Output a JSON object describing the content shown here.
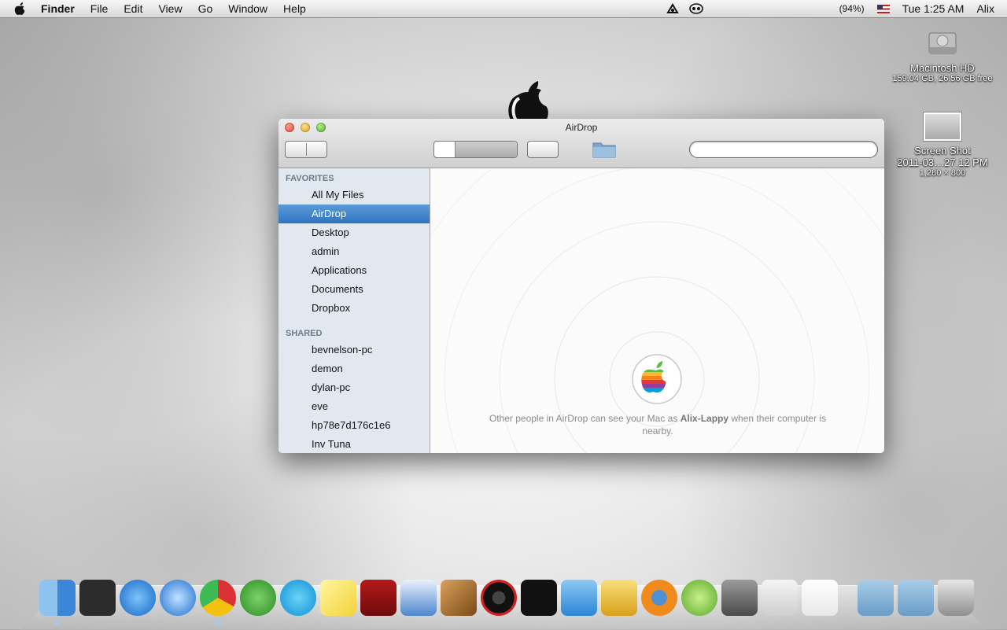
{
  "menubar": {
    "app_name": "Finder",
    "menus": [
      "File",
      "Edit",
      "View",
      "Go",
      "Window",
      "Help"
    ],
    "battery": "(94%)",
    "clock": "Tue 1:25 AM",
    "user": "Alix"
  },
  "desktop": {
    "hd_name": "Macintosh HD",
    "hd_sub": "159.04 GB, 26.56 GB free",
    "shot_name": "Screen Shot",
    "shot_date": "2011-03…27.12 PM",
    "shot_size": "1,280 × 800"
  },
  "window": {
    "title": "AirDrop"
  },
  "sidebar": {
    "favorites_head": "FAVORITES",
    "favorites": [
      "All My Files",
      "AirDrop",
      "Desktop",
      "admin",
      "Applications",
      "Documents",
      "Dropbox"
    ],
    "shared_head": "SHARED",
    "shared": [
      "bevnelson-pc",
      "demon",
      "dylan-pc",
      "eve",
      "hp78e7d176c1e6",
      "Inv Tuna"
    ]
  },
  "airdrop": {
    "msg_pre": "Other people in AirDrop can see your Mac as ",
    "mac_name": "Alix-Lappy",
    "msg_post": " when their computer is nearby."
  },
  "dock": {
    "apps": [
      "finder",
      "dashboard",
      "app-store",
      "itunes",
      "chrome",
      "utorrent",
      "skype",
      "stickies",
      "photo-booth",
      "openoffice",
      "garageband",
      "vinyl",
      "ableton-live",
      "dropbox",
      "tilde-app",
      "blender",
      "instant",
      "facetime",
      "unity",
      "textedit"
    ],
    "stacks": [
      "utilities",
      "folder",
      "trash"
    ]
  },
  "colors": {
    "accent": "#2f74c0",
    "sidebar_bg": "#e2e8f0"
  }
}
